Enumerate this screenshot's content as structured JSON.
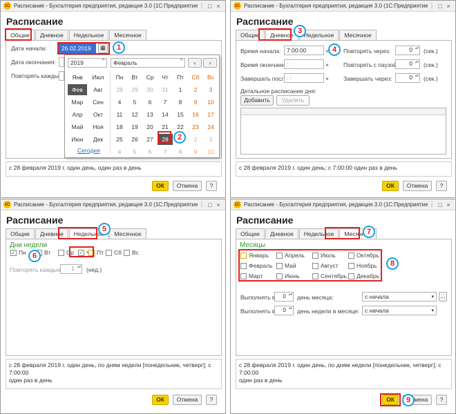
{
  "window_title": "Расписание - Бухгалтерия предприятия, редакция 3.0  (1С:Предприятие)",
  "heading": "Расписание",
  "tabs": [
    "Общие",
    "Дневное",
    "Недельное",
    "Месячное"
  ],
  "ok_label": "ОК",
  "cancel_label": "Отмена",
  "help_label": "?",
  "general": {
    "start_label": "Дата начала:",
    "start_value": "26.02.2019",
    "end_label": "Дата окончания:",
    "repeat_label": "Повторять каждые:",
    "summary": "с 28 февраля 2019 г. один день, один раз в день"
  },
  "calendar": {
    "year": "2019",
    "month": "Февраль",
    "months_col1": [
      "Янв",
      "Фев",
      "Мар",
      "Апр",
      "Май",
      "Июн"
    ],
    "months_col2": [
      "Июл",
      "Авг",
      "Сен",
      "Окт",
      "Ноя",
      "Дек"
    ],
    "weekdays": [
      "Пн",
      "Вт",
      "Ср",
      "Чт",
      "Пт",
      "Сб",
      "Вс"
    ],
    "days": [
      [
        "28",
        "29",
        "30",
        "31",
        "1",
        "2",
        "3"
      ],
      [
        "4",
        "5",
        "6",
        "7",
        "8",
        "9",
        "10"
      ],
      [
        "11",
        "12",
        "13",
        "14",
        "15",
        "16",
        "17"
      ],
      [
        "18",
        "19",
        "20",
        "21",
        "22",
        "23",
        "24"
      ],
      [
        "25",
        "26",
        "27",
        "28",
        "1",
        "2",
        "3"
      ],
      [
        "4",
        "5",
        "6",
        "7",
        "8",
        "9",
        "10"
      ]
    ],
    "today_label": "Сегодня",
    "prev": "‹",
    "next": "›",
    "nav_first": "^",
    "nav_second": "^"
  },
  "daily": {
    "start_label": "Время начала:",
    "start_value": "7:00:00",
    "end_label": "Время окончания:",
    "end_value": ": :",
    "finish_label": "Завершать после:",
    "finish_value": ": :",
    "repeat_label": "Повторять через:",
    "repeat_value": "0",
    "pause_label": "Повторять с паузой:",
    "pause_value": "0",
    "complete_label": "Завершать через:",
    "complete_value": "0",
    "unit": "(сек.)",
    "detail_label": "Детальное расписание дня:",
    "add_label": "Добавить",
    "delete_label": "Удалить",
    "summary": "с 28 февраля 2019 г. один день; с 7:00:00 один раз в день"
  },
  "weekly": {
    "group_label": "Дни недели",
    "days": [
      "Пн",
      "Вт",
      "Ср",
      "Чт",
      "Пт",
      "Сб",
      "Вс"
    ],
    "repeat_label": "Повторять каждые:",
    "repeat_value": "1",
    "unit": "(нед.)",
    "summary_line1": "с 28 февраля 2019 г. один день, по дням недели [понедельник, четверг]; с 7:00:00",
    "summary_line2": "один раз в день"
  },
  "monthly": {
    "group_label": "Месяцы",
    "months": [
      "Январь",
      "Февраль",
      "Март",
      "Апрель",
      "Май",
      "Июнь",
      "Июль",
      "Август",
      "Сентябрь",
      "Октябрь",
      "Ноябрь",
      "Декабрь"
    ],
    "run_label": "Выполнять в:",
    "day_value": "0",
    "day_of_month_label": "день месяца:",
    "week_value": "0",
    "day_of_week_label": "день недели в месяце:",
    "from_start": "с начала",
    "summary_line1": "с 28 февраля 2019 г. один день, по дням недели [понедельник, четверг]; с 7:00:00",
    "summary_line2": "один раз в день"
  },
  "badges": [
    "1",
    "2",
    "3",
    "4",
    "5",
    "6",
    "7",
    "8",
    "9"
  ],
  "colors": {
    "accent_red": "#e02020",
    "badge_border": "#1aa0e0",
    "ok_yellow": "#f7d100",
    "weekend": "#e05a00"
  }
}
